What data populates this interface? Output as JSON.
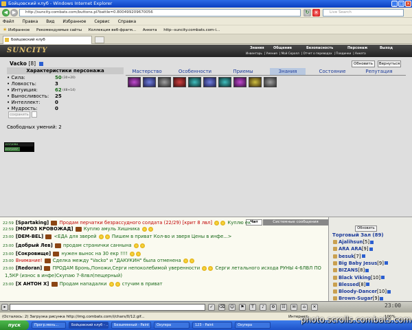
{
  "window": {
    "title": "Бойцовский клуб - Windows Internet Explorer"
  },
  "address": {
    "url": "http://suncity.combats.com/buttons.pl?battle=0.800499209670056",
    "live_search": "Live Search"
  },
  "menu": [
    "Файл",
    "Правка",
    "Вид",
    "Избранное",
    "Сервис",
    "Справка"
  ],
  "favorites": [
    "Избранное",
    "Рекомендуемые сайты",
    "Коллекция веб-фрагм...",
    "Анкета",
    "http--suncity.combats.com-i..."
  ],
  "tab": {
    "title": "Бойцовский клуб"
  },
  "game": {
    "logo": "SUNCITY",
    "topnav": [
      "Знания",
      "Общение",
      "Безопасность",
      "Персонаж",
      "Выход"
    ],
    "subnav": [
      "Инвентарь",
      "Умения",
      "Мой Скролл",
      "Отчет о переводах",
      "Поединки",
      "Анкета"
    ],
    "character": {
      "name": "Vacko",
      "level": "[8]"
    },
    "buttons": {
      "refresh": "Обновить",
      "back": "Вернуться"
    },
    "stats_header": "Характеристики персонажа",
    "stats": [
      {
        "name": "• Сила:",
        "value": "50",
        "bonus": "(30+20)",
        "green": true
      },
      {
        "name": "• Ловкость:",
        "value": "3",
        "bonus": "",
        "green": false
      },
      {
        "name": "• Интуиция:",
        "value": "62",
        "bonus": "(48+14)",
        "green": true
      },
      {
        "name": "• Выносливость:",
        "value": "25",
        "bonus": "",
        "green": false
      },
      {
        "name": "• Интеллект:",
        "value": "0",
        "bonus": "",
        "green": false
      },
      {
        "name": "• Мудрость:",
        "value": "0",
        "bonus": "",
        "green": false
      }
    ],
    "save_label": "сохранить",
    "free_skills": "Свободных умений: 2",
    "hp_text": "1537/4364",
    "mana_text": "1537/1537",
    "tabs": [
      "Мастерство",
      "Особенности",
      "Приемы",
      "Знания",
      "Состояние",
      "Репутация"
    ],
    "active_tab": "Знания"
  },
  "chat": {
    "tab_chat": "Чат",
    "tab_system": "Системные сообщения",
    "lines": [
      {
        "time": "22:59",
        "nick": "[Spartaking]",
        "msg": "Продам перчатки безрассудного солдата (22/29) [крит 8 лвл]",
        "tail": "Куплю ек",
        "red": true
      },
      {
        "time": "22:59",
        "nick": "[МОРОЗ КРОВОЖАД]",
        "msg": "Куплю амуль Хишника",
        "tail": "",
        "red": false
      },
      {
        "time": "23:00",
        "nick": "[DEM-BEL]",
        "msg": "<ЕДА для зверей",
        "tail": "Пишем в приват   Кол-во и зверя   Цены в инфе...>",
        "red": false
      },
      {
        "time": "23:00",
        "nick": "[добрый Лев]",
        "msg": "продам странички саннына",
        "tail": "",
        "red": false
      },
      {
        "time": "23:00",
        "nick": "[Сокровище]",
        "msg": "нужен вынос на 30 екр !!!!",
        "tail": "",
        "red": false
      },
      {
        "time": "23:00",
        "nick": "Внимание!",
        "msg": "Сделка между \"Vacko\" и \"ДАКУКИН\" была отменена",
        "tail": "",
        "red": true
      },
      {
        "time": "23:00",
        "nick": "[Redoran]",
        "msg": "ПРОДАМ Бронь,Поножи,Серги непоколебимой уверенности",
        "tail": "Серги летального исхода   РУНЫ 4-6ЛВЛ ПО",
        "red": false
      },
      {
        "time": "",
        "nick": "",
        "msg": "1,5КР (износ в инфе)Скупаю 7-8лвл(пещерный)",
        "tail": "",
        "red": false
      },
      {
        "time": "23:00",
        "nick": "[X АНТОН X]",
        "msg": "Продам нападалки",
        "tail": "стучим в приват",
        "red": false
      }
    ]
  },
  "online": {
    "refresh": "Обновить",
    "room": "Торговый Зал (89)",
    "users": [
      {
        "name": "Ajalihsun",
        "level": "[5]"
      },
      {
        "name": "ARA ARA",
        "level": "[9]"
      },
      {
        "name": "besuk",
        "level": "[7]"
      },
      {
        "name": "Big Baby Jesus",
        "level": "[9]"
      },
      {
        "name": "BIZANS",
        "level": "[8]"
      },
      {
        "name": "Black Viking",
        "level": "[10]"
      },
      {
        "name": "Blessed",
        "level": "[8]"
      },
      {
        "name": "Bloody-Dancer",
        "level": "[10]"
      },
      {
        "name": "Brown-Sugar",
        "level": "[9]"
      }
    ]
  },
  "clock": "23:00",
  "statusbar": {
    "text": "(Осталось: 2) Загрузка рисунка http://img.combats.com/i/chars/0/12.gif...",
    "zone": "Интернет",
    "zoom": "100%"
  },
  "taskbar": {
    "start": "пуск",
    "tasks": [
      "Прогр.мень...",
      "Бойцовский клуб - ...",
      "Безымянный - Paint",
      "Oxyrepa",
      "123 - Paint",
      "Oxyrepa"
    ]
  },
  "watermark": "photo.scrolls.combats.com"
}
